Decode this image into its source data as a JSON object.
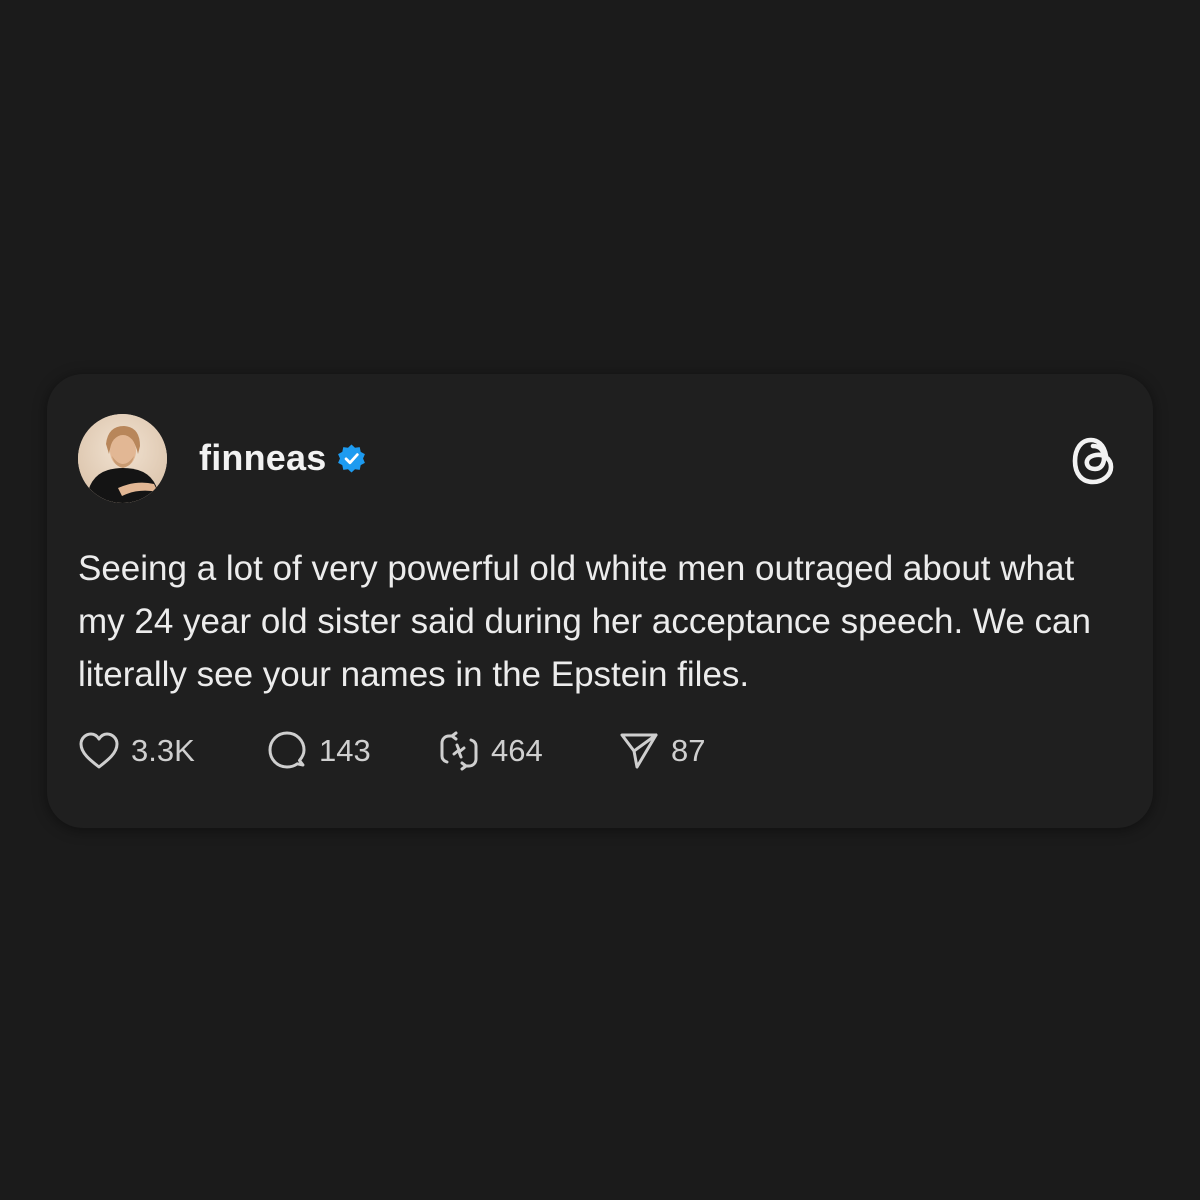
{
  "post": {
    "author": {
      "username": "finneas",
      "verified": true,
      "avatar_icon": "profile-photo"
    },
    "platform_icon": "threads-logo-icon",
    "text": "Seeing a lot of very powerful old white men outraged about what my 24 year old sister said during her acceptance speech. We can literally see your names in the Epstein files.",
    "actions": {
      "like_count": "3.3K",
      "reply_count": "143",
      "repost_count": "464",
      "share_count": "87"
    },
    "icons": {
      "like": "heart-icon",
      "reply": "speech-bubble-icon",
      "repost": "repost-arrows-icon",
      "share": "paper-plane-icon",
      "verified": "verified-badge-icon"
    },
    "colors": {
      "background": "#1b1b1b",
      "card": "#1f1f1f",
      "verified_badge": "#1d9bf0",
      "text": "#ececec"
    }
  }
}
